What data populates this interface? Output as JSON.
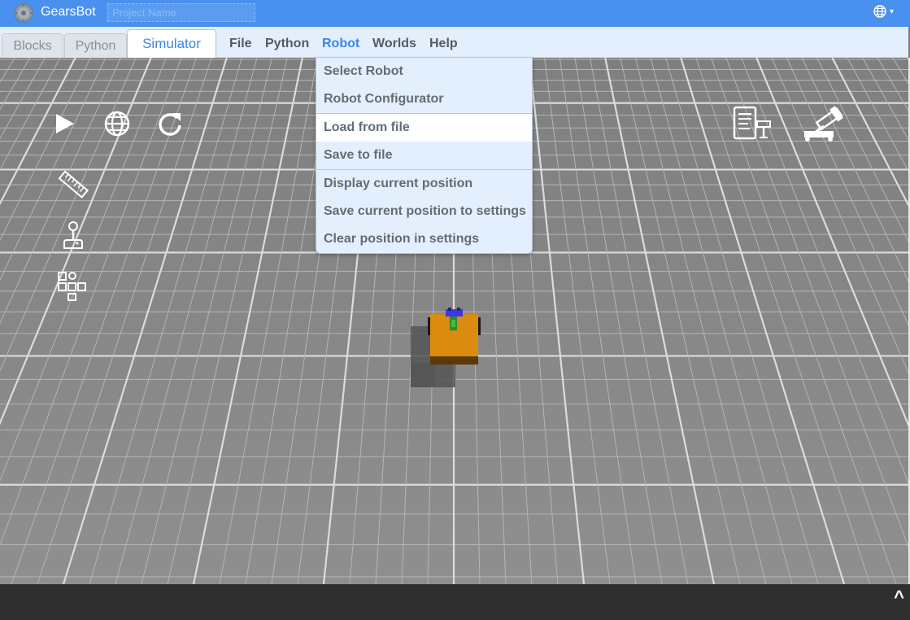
{
  "app": {
    "name": "GearsBot",
    "project_placeholder": "Project Name"
  },
  "language": {
    "icon": "globe-icon",
    "arrow": "▾"
  },
  "tabs": [
    {
      "label": "Blocks"
    },
    {
      "label": "Python"
    },
    {
      "label": "Simulator",
      "active": true
    }
  ],
  "menu": [
    {
      "label": "File"
    },
    {
      "label": "Python"
    },
    {
      "label": "Robot",
      "active": true
    },
    {
      "label": "Worlds"
    },
    {
      "label": "Help"
    }
  ],
  "robot_menu": {
    "items": [
      {
        "label": "Select Robot"
      },
      {
        "label": "Robot Configurator"
      },
      {
        "label": "Load from file",
        "highlighted": true
      },
      {
        "label": "Save to file"
      },
      {
        "label": "Display current position"
      },
      {
        "label": "Save current position to settings"
      },
      {
        "label": "Clear position in settings"
      }
    ]
  },
  "toolbar_icons": [
    "play-icon",
    "globe-icon",
    "reset-icon",
    "ruler-icon",
    "joystick-icon",
    "blocks-icon",
    "camera-config-icon",
    "robot-arm-icon"
  ],
  "bottom": {
    "toggle": "^"
  },
  "colors": {
    "title_bg": "#4a90ee",
    "menubar_bg": "#e3effd",
    "accent": "#3a86e8",
    "robot_body": "#d98c10"
  }
}
